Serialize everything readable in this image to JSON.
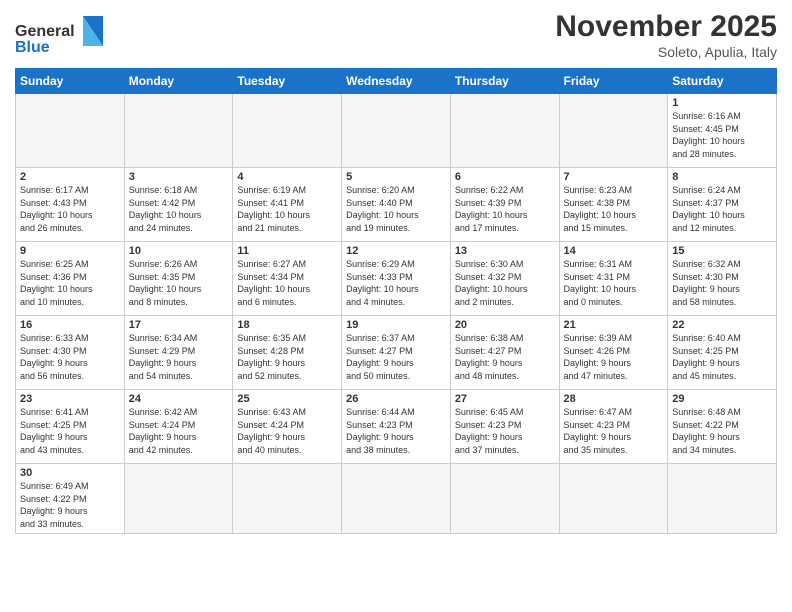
{
  "header": {
    "logo_general": "General",
    "logo_blue": "Blue",
    "month_title": "November 2025",
    "location": "Soleto, Apulia, Italy"
  },
  "days_of_week": [
    "Sunday",
    "Monday",
    "Tuesday",
    "Wednesday",
    "Thursday",
    "Friday",
    "Saturday"
  ],
  "weeks": [
    {
      "days": [
        {
          "number": "",
          "info": ""
        },
        {
          "number": "",
          "info": ""
        },
        {
          "number": "",
          "info": ""
        },
        {
          "number": "",
          "info": ""
        },
        {
          "number": "",
          "info": ""
        },
        {
          "number": "",
          "info": ""
        },
        {
          "number": "1",
          "info": "Sunrise: 6:16 AM\nSunset: 4:45 PM\nDaylight: 10 hours\nand 28 minutes."
        }
      ]
    },
    {
      "days": [
        {
          "number": "2",
          "info": "Sunrise: 6:17 AM\nSunset: 4:43 PM\nDaylight: 10 hours\nand 26 minutes."
        },
        {
          "number": "3",
          "info": "Sunrise: 6:18 AM\nSunset: 4:42 PM\nDaylight: 10 hours\nand 24 minutes."
        },
        {
          "number": "4",
          "info": "Sunrise: 6:19 AM\nSunset: 4:41 PM\nDaylight: 10 hours\nand 21 minutes."
        },
        {
          "number": "5",
          "info": "Sunrise: 6:20 AM\nSunset: 4:40 PM\nDaylight: 10 hours\nand 19 minutes."
        },
        {
          "number": "6",
          "info": "Sunrise: 6:22 AM\nSunset: 4:39 PM\nDaylight: 10 hours\nand 17 minutes."
        },
        {
          "number": "7",
          "info": "Sunrise: 6:23 AM\nSunset: 4:38 PM\nDaylight: 10 hours\nand 15 minutes."
        },
        {
          "number": "8",
          "info": "Sunrise: 6:24 AM\nSunset: 4:37 PM\nDaylight: 10 hours\nand 12 minutes."
        }
      ]
    },
    {
      "days": [
        {
          "number": "9",
          "info": "Sunrise: 6:25 AM\nSunset: 4:36 PM\nDaylight: 10 hours\nand 10 minutes."
        },
        {
          "number": "10",
          "info": "Sunrise: 6:26 AM\nSunset: 4:35 PM\nDaylight: 10 hours\nand 8 minutes."
        },
        {
          "number": "11",
          "info": "Sunrise: 6:27 AM\nSunset: 4:34 PM\nDaylight: 10 hours\nand 6 minutes."
        },
        {
          "number": "12",
          "info": "Sunrise: 6:29 AM\nSunset: 4:33 PM\nDaylight: 10 hours\nand 4 minutes."
        },
        {
          "number": "13",
          "info": "Sunrise: 6:30 AM\nSunset: 4:32 PM\nDaylight: 10 hours\nand 2 minutes."
        },
        {
          "number": "14",
          "info": "Sunrise: 6:31 AM\nSunset: 4:31 PM\nDaylight: 10 hours\nand 0 minutes."
        },
        {
          "number": "15",
          "info": "Sunrise: 6:32 AM\nSunset: 4:30 PM\nDaylight: 9 hours\nand 58 minutes."
        }
      ]
    },
    {
      "days": [
        {
          "number": "16",
          "info": "Sunrise: 6:33 AM\nSunset: 4:30 PM\nDaylight: 9 hours\nand 56 minutes."
        },
        {
          "number": "17",
          "info": "Sunrise: 6:34 AM\nSunset: 4:29 PM\nDaylight: 9 hours\nand 54 minutes."
        },
        {
          "number": "18",
          "info": "Sunrise: 6:35 AM\nSunset: 4:28 PM\nDaylight: 9 hours\nand 52 minutes."
        },
        {
          "number": "19",
          "info": "Sunrise: 6:37 AM\nSunset: 4:27 PM\nDaylight: 9 hours\nand 50 minutes."
        },
        {
          "number": "20",
          "info": "Sunrise: 6:38 AM\nSunset: 4:27 PM\nDaylight: 9 hours\nand 48 minutes."
        },
        {
          "number": "21",
          "info": "Sunrise: 6:39 AM\nSunset: 4:26 PM\nDaylight: 9 hours\nand 47 minutes."
        },
        {
          "number": "22",
          "info": "Sunrise: 6:40 AM\nSunset: 4:25 PM\nDaylight: 9 hours\nand 45 minutes."
        }
      ]
    },
    {
      "days": [
        {
          "number": "23",
          "info": "Sunrise: 6:41 AM\nSunset: 4:25 PM\nDaylight: 9 hours\nand 43 minutes."
        },
        {
          "number": "24",
          "info": "Sunrise: 6:42 AM\nSunset: 4:24 PM\nDaylight: 9 hours\nand 42 minutes."
        },
        {
          "number": "25",
          "info": "Sunrise: 6:43 AM\nSunset: 4:24 PM\nDaylight: 9 hours\nand 40 minutes."
        },
        {
          "number": "26",
          "info": "Sunrise: 6:44 AM\nSunset: 4:23 PM\nDaylight: 9 hours\nand 38 minutes."
        },
        {
          "number": "27",
          "info": "Sunrise: 6:45 AM\nSunset: 4:23 PM\nDaylight: 9 hours\nand 37 minutes."
        },
        {
          "number": "28",
          "info": "Sunrise: 6:47 AM\nSunset: 4:23 PM\nDaylight: 9 hours\nand 35 minutes."
        },
        {
          "number": "29",
          "info": "Sunrise: 6:48 AM\nSunset: 4:22 PM\nDaylight: 9 hours\nand 34 minutes."
        }
      ]
    },
    {
      "days": [
        {
          "number": "30",
          "info": "Sunrise: 6:49 AM\nSunset: 4:22 PM\nDaylight: 9 hours\nand 33 minutes."
        },
        {
          "number": "",
          "info": ""
        },
        {
          "number": "",
          "info": ""
        },
        {
          "number": "",
          "info": ""
        },
        {
          "number": "",
          "info": ""
        },
        {
          "number": "",
          "info": ""
        },
        {
          "number": "",
          "info": ""
        }
      ]
    }
  ]
}
